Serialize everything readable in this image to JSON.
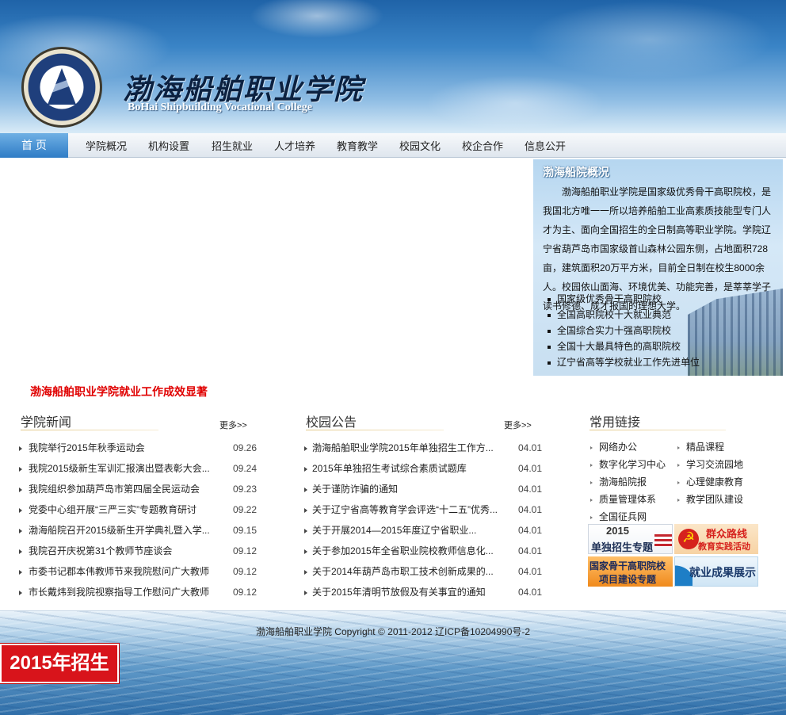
{
  "header": {
    "title_cn": "渤海船舶职业学院",
    "title_en": "BoHai Shipbuilding Vocational College"
  },
  "nav": {
    "home": "首 页",
    "items": [
      "学院概况",
      "机构设置",
      "招生就业",
      "人才培养",
      "教育教学",
      "校园文化",
      "校企合作",
      "信息公开"
    ]
  },
  "intro": {
    "title": "渤海船院概况",
    "text": "渤海船舶职业学院是国家级优秀骨干高职院校，是我国北方唯一一所以培养船舶工业高素质技能型专门人才为主、面向全国招生的全日制高等职业学院。学院辽宁省葫芦岛市国家级首山森林公园东侧，占地面积728亩，建筑面积20万平方米，目前全日制在校生8000余人。校园依山面海、环境优美、功能完善，是莘莘学子读书修德、成才报国的理想大学。",
    "bullets": [
      "国家级优秀骨干高职院校",
      "全国高职院校十大就业典范",
      "全国综合实力十强高职院校",
      "全国十大最具特色的高职院校",
      "辽宁省高等学校就业工作先进单位"
    ]
  },
  "headline": "渤海船舶职业学院就业工作成效显著",
  "news": {
    "title": "学院新闻",
    "more": "更多>>",
    "items": [
      {
        "title": "我院举行2015年秋季运动会",
        "date": "09.26"
      },
      {
        "title": "我院2015级新生军训汇报演出暨表彰大会...",
        "date": "09.24"
      },
      {
        "title": "我院组织参加葫芦岛市第四届全民运动会",
        "date": "09.23"
      },
      {
        "title": "党委中心组开展“三严三实”专题教育研讨",
        "date": "09.22"
      },
      {
        "title": "渤海船院召开2015级新生开学典礼暨入学...",
        "date": "09.15"
      },
      {
        "title": "我院召开庆祝第31个教师节座谈会",
        "date": "09.12"
      },
      {
        "title": "市委书记郡本伟教师节来我院慰问广大教师",
        "date": "09.12"
      },
      {
        "title": "市长戴炜到我院视察指导工作慰问广大教师",
        "date": "09.12"
      }
    ]
  },
  "notices": {
    "title": "校园公告",
    "more": "更多>>",
    "items": [
      {
        "title": "渤海船舶职业学院2015年单独招生工作方...",
        "date": "04.01"
      },
      {
        "title": "2015年单独招生考试综合素质试题库",
        "date": "04.01"
      },
      {
        "title": "关于谨防诈骗的通知",
        "date": "04.01"
      },
      {
        "title": "关于辽宁省高等教育学会评选“十二五”优秀...",
        "date": "04.01"
      },
      {
        "title": "关于开展2014—2015年度辽宁省职业...",
        "date": "04.01"
      },
      {
        "title": "关于参加2015年全省职业院校教师信息化...",
        "date": "04.01"
      },
      {
        "title": "关于2014年葫芦岛市职工技术创新成果的...",
        "date": "04.01"
      },
      {
        "title": "关于2015年清明节放假及有关事宜的通知",
        "date": "04.01"
      }
    ]
  },
  "links": {
    "title": "常用链接",
    "items": [
      "网络办公",
      "精品课程",
      "数字化学习中心",
      "学习交流园地",
      "渤海船院报",
      "心理健康教育",
      "质量管理体系",
      "教学团队建设",
      "全国征兵网"
    ]
  },
  "banners": {
    "b1_line1": "2015",
    "b1_line2": "单独招生专题",
    "b2_line1": "群众路线",
    "b2_line2": "教育实践活动",
    "b3_line1": "国家骨干高职院校",
    "b3_line2": "项目建设专题",
    "b4_line1": "就业成果展示"
  },
  "footer": {
    "copyright": "渤海船舶职业学院  Copyright © 2011-2012 辽ICP备10204990号-2",
    "badge": "2015年招生"
  },
  "colors": {
    "headline": "#e00000",
    "nav_active": "#2f7cc6",
    "badge": "#d8141b"
  },
  "icons": {
    "logo": "college-seal-icon",
    "bullet": "triangle-bullet-icon"
  }
}
